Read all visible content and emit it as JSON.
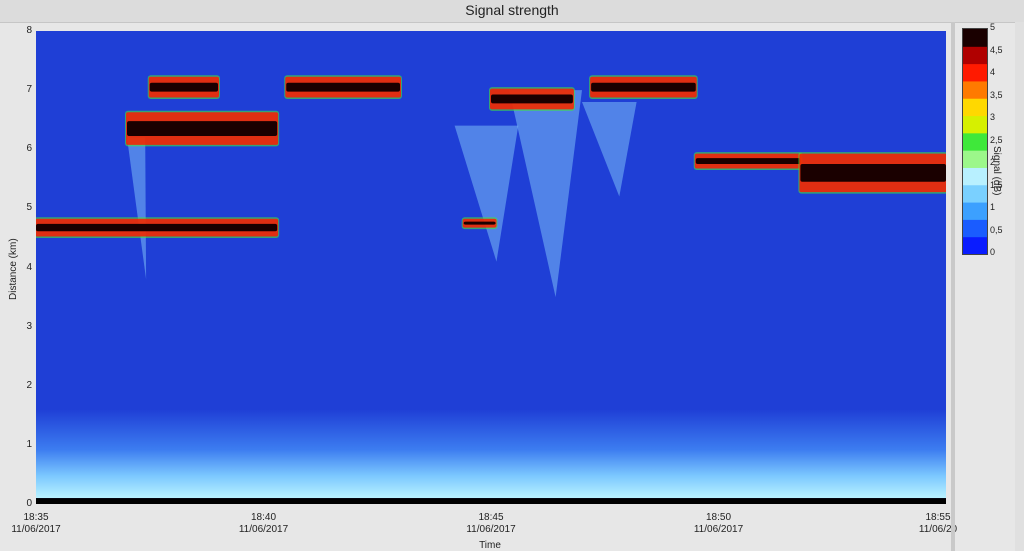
{
  "window": {
    "title": "Signal strength"
  },
  "chart_data": {
    "type": "heatmap",
    "title": "Signal strength",
    "xlabel": "Time",
    "ylabel": "Distance (km)",
    "colorbar_label": "Signal (dB)",
    "x_ticks": [
      {
        "time": "18:35",
        "date": "11/06/2017"
      },
      {
        "time": "18:40",
        "date": "11/06/2017"
      },
      {
        "time": "18:45",
        "date": "11/06/2017"
      },
      {
        "time": "18:50",
        "date": "11/06/2017"
      },
      {
        "time": "18:55",
        "date": "11/06/20"
      }
    ],
    "x_range": [
      "18:35",
      "18:55"
    ],
    "y_ticks": [
      "0",
      "1",
      "2",
      "3",
      "4",
      "5",
      "6",
      "7",
      "8"
    ],
    "y_range": [
      0,
      8
    ],
    "colorbar_ticks": [
      "0",
      "0,5",
      "1",
      "1,5",
      "2",
      "2,5",
      "3",
      "3,5",
      "4",
      "4,5",
      "5"
    ],
    "colorbar_range": [
      0,
      5
    ],
    "colorscale": [
      "#0a1cff",
      "#1a5cff",
      "#3ca0ff",
      "#7ad0ff",
      "#b8f0ff",
      "#9cf78a",
      "#3fe83a",
      "#d6f000",
      "#ffd800",
      "#ff7a00",
      "#ff1a00",
      "#b00000",
      "#1a0000"
    ],
    "background_color": "#1f3fd6",
    "features": [
      {
        "name": "echo",
        "t0": "18:35",
        "t1": "18:40.3",
        "d0": 4.55,
        "d1": 4.8,
        "peak_db": 5
      },
      {
        "name": "echo",
        "t0": "18:37",
        "t1": "18:40.3",
        "d0": 6.1,
        "d1": 6.6,
        "peak_db": 5
      },
      {
        "name": "echo",
        "t0": "18:37.5",
        "t1": "18:39",
        "d0": 6.9,
        "d1": 7.2,
        "peak_db": 5
      },
      {
        "name": "echo",
        "t0": "18:40.5",
        "t1": "18:43",
        "d0": 6.9,
        "d1": 7.2,
        "peak_db": 5
      },
      {
        "name": "echo",
        "t0": "18:44.4",
        "t1": "18:45.1",
        "d0": 4.7,
        "d1": 4.8,
        "peak_db": 5
      },
      {
        "name": "echo",
        "t0": "18:45",
        "t1": "18:46.8",
        "d0": 6.7,
        "d1": 7.0,
        "peak_db": 5
      },
      {
        "name": "echo",
        "t0": "18:47.2",
        "t1": "18:49.5",
        "d0": 6.9,
        "d1": 7.2,
        "peak_db": 5
      },
      {
        "name": "echo",
        "t0": "18:49.5",
        "t1": "18:51.8",
        "d0": 5.7,
        "d1": 5.9,
        "peak_db": 5
      },
      {
        "name": "echo",
        "t0": "18:51.8",
        "t1": "18:55",
        "d0": 5.3,
        "d1": 5.9,
        "peak_db": 5
      }
    ],
    "grid": false
  }
}
